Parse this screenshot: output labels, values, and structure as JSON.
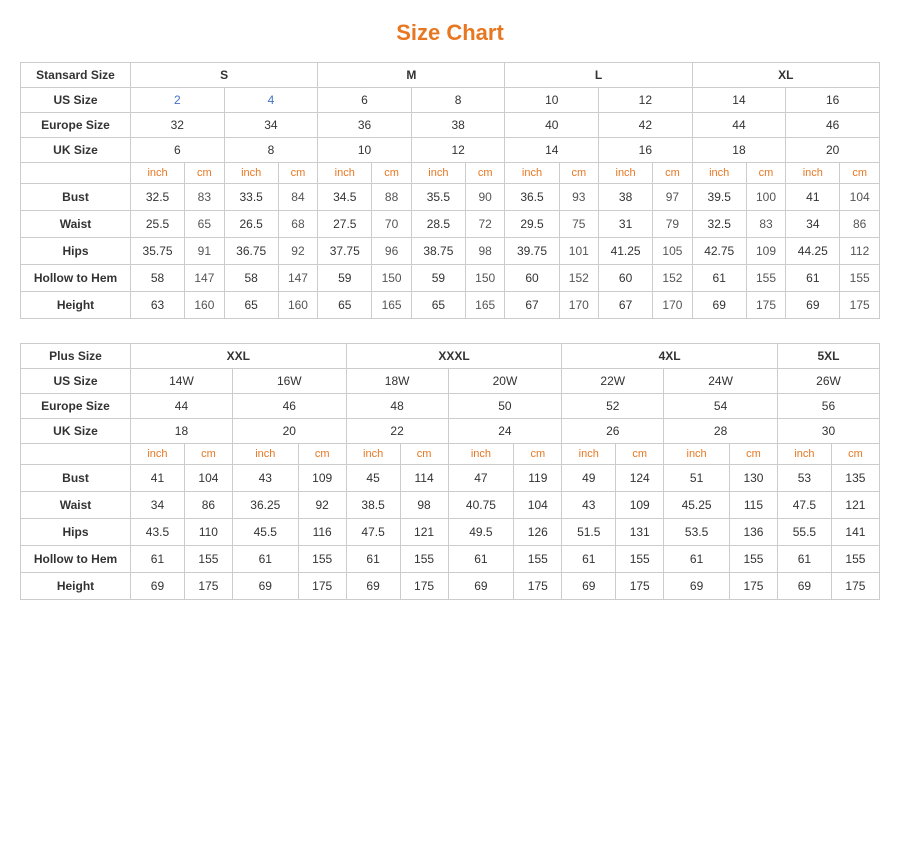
{
  "title": "Size Chart",
  "standard": {
    "label": "Stansard Size",
    "groups": [
      {
        "label": "S",
        "cols": 4
      },
      {
        "label": "M",
        "cols": 4
      },
      {
        "label": "L",
        "cols": 4
      },
      {
        "label": "XL",
        "cols": 4
      }
    ],
    "us_sizes": [
      "2",
      "4",
      "6",
      "8",
      "10",
      "12",
      "14",
      "16"
    ],
    "europe_sizes": [
      "32",
      "34",
      "36",
      "38",
      "40",
      "42",
      "44",
      "46"
    ],
    "uk_sizes": [
      "6",
      "8",
      "10",
      "12",
      "14",
      "16",
      "18",
      "20"
    ],
    "unit_row": [
      "inch",
      "cm",
      "inch",
      "cm",
      "inch",
      "cm",
      "inch",
      "cm",
      "inch",
      "cm",
      "inch",
      "cm",
      "inch",
      "cm",
      "inch",
      "cm"
    ],
    "rows": [
      {
        "label": "Bust",
        "values": [
          "32.5",
          "83",
          "33.5",
          "84",
          "34.5",
          "88",
          "35.5",
          "90",
          "36.5",
          "93",
          "38",
          "97",
          "39.5",
          "100",
          "41",
          "104"
        ]
      },
      {
        "label": "Waist",
        "values": [
          "25.5",
          "65",
          "26.5",
          "68",
          "27.5",
          "70",
          "28.5",
          "72",
          "29.5",
          "75",
          "31",
          "79",
          "32.5",
          "83",
          "34",
          "86"
        ]
      },
      {
        "label": "Hips",
        "values": [
          "35.75",
          "91",
          "36.75",
          "92",
          "37.75",
          "96",
          "38.75",
          "98",
          "39.75",
          "101",
          "41.25",
          "105",
          "42.75",
          "109",
          "44.25",
          "112"
        ]
      },
      {
        "label": "Hollow to Hem",
        "values": [
          "58",
          "147",
          "58",
          "147",
          "59",
          "150",
          "59",
          "150",
          "60",
          "152",
          "60",
          "152",
          "61",
          "155",
          "61",
          "155"
        ]
      },
      {
        "label": "Height",
        "values": [
          "63",
          "160",
          "65",
          "160",
          "65",
          "165",
          "65",
          "165",
          "67",
          "170",
          "67",
          "170",
          "69",
          "175",
          "69",
          "175"
        ]
      }
    ]
  },
  "plus": {
    "label": "Plus Size",
    "groups": [
      {
        "label": "XXL",
        "cols": 4
      },
      {
        "label": "XXXL",
        "cols": 4
      },
      {
        "label": "4XL",
        "cols": 4
      },
      {
        "label": "5XL",
        "cols": 2
      }
    ],
    "us_sizes": [
      "14W",
      "16W",
      "18W",
      "20W",
      "22W",
      "24W",
      "26W"
    ],
    "europe_sizes": [
      "44",
      "46",
      "48",
      "50",
      "52",
      "54",
      "56"
    ],
    "uk_sizes": [
      "18",
      "20",
      "22",
      "24",
      "26",
      "28",
      "30"
    ],
    "unit_row": [
      "inch",
      "cm",
      "inch",
      "cm",
      "inch",
      "cm",
      "inch",
      "cm",
      "inch",
      "cm",
      "inch",
      "cm",
      "inch",
      "cm"
    ],
    "rows": [
      {
        "label": "Bust",
        "values": [
          "41",
          "104",
          "43",
          "109",
          "45",
          "114",
          "47",
          "119",
          "49",
          "124",
          "51",
          "130",
          "53",
          "135"
        ]
      },
      {
        "label": "Waist",
        "values": [
          "34",
          "86",
          "36.25",
          "92",
          "38.5",
          "98",
          "40.75",
          "104",
          "43",
          "109",
          "45.25",
          "115",
          "47.5",
          "121"
        ]
      },
      {
        "label": "Hips",
        "values": [
          "43.5",
          "110",
          "45.5",
          "116",
          "47.5",
          "121",
          "49.5",
          "126",
          "51.5",
          "131",
          "53.5",
          "136",
          "55.5",
          "141"
        ]
      },
      {
        "label": "Hollow to Hem",
        "values": [
          "61",
          "155",
          "61",
          "155",
          "61",
          "155",
          "61",
          "155",
          "61",
          "155",
          "61",
          "155",
          "61",
          "155"
        ]
      },
      {
        "label": "Height",
        "values": [
          "69",
          "175",
          "69",
          "175",
          "69",
          "175",
          "69",
          "175",
          "69",
          "175",
          "69",
          "175",
          "69",
          "175"
        ]
      }
    ]
  }
}
